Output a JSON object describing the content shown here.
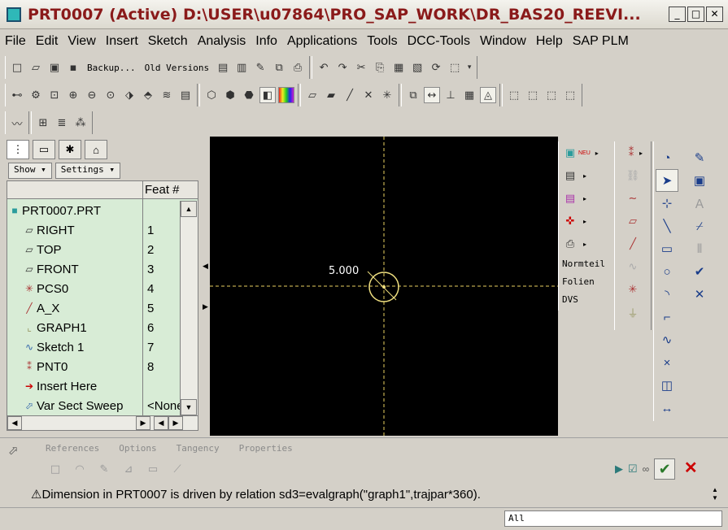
{
  "window": {
    "title": "PRT0007 (Active) D:\\USER\\u07864\\PRO_SAP_WORK\\DR_BAS20_REEVI...",
    "minimize": "_",
    "maximize": "□",
    "close": "✕"
  },
  "menu": [
    "File",
    "Edit",
    "View",
    "Insert",
    "Sketch",
    "Analysis",
    "Info",
    "Applications",
    "Tools",
    "DCC-Tools",
    "Window",
    "Help",
    "SAP PLM"
  ],
  "toolbar": {
    "backup_label": "Backup...",
    "old_versions_label": "Old Versions"
  },
  "left_panel": {
    "show_label": "Show ▾",
    "settings_label": "Settings ▾",
    "feat_header": "Feat #",
    "items": [
      {
        "name": "PRT0007.PRT",
        "feat": "",
        "icon": "part-icon"
      },
      {
        "name": "RIGHT",
        "feat": "1",
        "icon": "datum-plane-icon"
      },
      {
        "name": "TOP",
        "feat": "2",
        "icon": "datum-plane-icon"
      },
      {
        "name": "FRONT",
        "feat": "3",
        "icon": "datum-plane-icon"
      },
      {
        "name": "PCS0",
        "feat": "4",
        "icon": "coordinate-system-icon"
      },
      {
        "name": "A_X",
        "feat": "5",
        "icon": "datum-axis-icon"
      },
      {
        "name": "GRAPH1",
        "feat": "6",
        "icon": "graph-icon"
      },
      {
        "name": "Sketch 1",
        "feat": "7",
        "icon": "sketch-icon"
      },
      {
        "name": "PNT0",
        "feat": "8",
        "icon": "datum-point-icon"
      },
      {
        "name": "Insert Here",
        "feat": "",
        "icon": "insert-here-icon"
      },
      {
        "name": "Var Sect Sweep",
        "feat": "<None",
        "icon": "var-sect-sweep-icon"
      }
    ]
  },
  "graphics": {
    "dimension_value": "5.000"
  },
  "palette": {
    "neu_label": "NEU",
    "normteil_label": "Normteil",
    "folien_label": "Folien",
    "dvs_label": "DVS"
  },
  "dashboard": {
    "tabs": [
      "References",
      "Options",
      "Tangency",
      "Properties"
    ]
  },
  "message": "Dimension in PRT0007 is driven by relation sd3=evalgraph(\"graph1\",trajpar*360).",
  "filter": "All",
  "colors": {
    "title_text": "#8a1a1a",
    "tree_bg": "#d8ecd6",
    "datum_line": "#e8d060"
  }
}
